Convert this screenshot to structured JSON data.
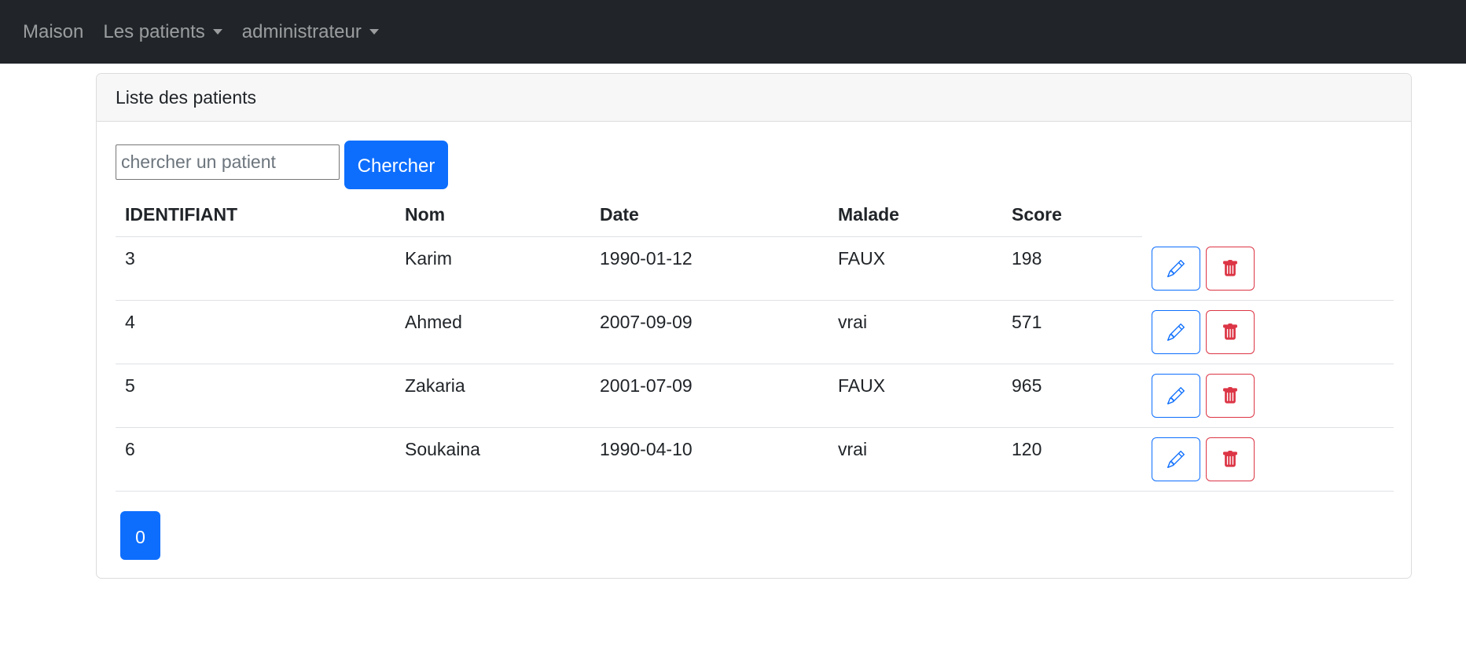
{
  "navbar": {
    "home": "Maison",
    "patients_menu": "Les patients",
    "admin_menu": "administrateur"
  },
  "card": {
    "title": "Liste des patients"
  },
  "search": {
    "placeholder": "chercher un patient",
    "value": "",
    "button_label": "Chercher"
  },
  "table": {
    "headers": {
      "id": "IDENTIFIANT",
      "nom": "Nom",
      "date": "Date",
      "malade": "Malade",
      "score": "Score"
    },
    "rows": [
      {
        "id": "3",
        "nom": "Karim",
        "date": "1990-01-12",
        "malade": "FAUX",
        "score": "198"
      },
      {
        "id": "4",
        "nom": "Ahmed",
        "date": "2007-09-09",
        "malade": "vrai",
        "score": "571"
      },
      {
        "id": "5",
        "nom": "Zakaria",
        "date": "2001-07-09",
        "malade": "FAUX",
        "score": "965"
      },
      {
        "id": "6",
        "nom": "Soukaina",
        "date": "1990-04-10",
        "malade": "vrai",
        "score": "120"
      }
    ],
    "actions": {
      "edit_icon": "pencil-icon",
      "delete_icon": "trash-icon"
    }
  },
  "pagination": {
    "pages": [
      "0"
    ],
    "current": "0"
  },
  "colors": {
    "navbar_bg": "#212529",
    "primary": "#0d6efd",
    "danger": "#dc3545"
  }
}
